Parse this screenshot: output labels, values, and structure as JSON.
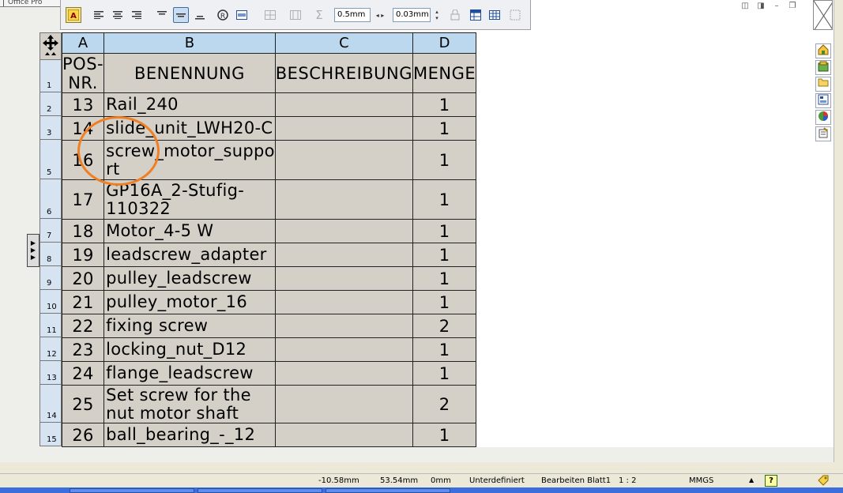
{
  "window": {
    "office_tab": "Office Pro",
    "controls": [
      "◫",
      "◨",
      "–",
      "❐"
    ]
  },
  "toolbar": {
    "line_width": "0.5mm",
    "offset": "0.03mm"
  },
  "table": {
    "columns": [
      "A",
      "B",
      "C",
      "D"
    ],
    "header": [
      "POS-NR.",
      "BENENNUNG",
      "BESCHREIBUNG",
      "MENGE"
    ],
    "rows": [
      {
        "num": "2",
        "pos": "13",
        "name": "Rail_240",
        "desc": "",
        "qty": "1"
      },
      {
        "num": "3",
        "pos": "14",
        "name": "slide_unit_LWH20-C",
        "desc": "",
        "qty": "1"
      },
      {
        "num": "5",
        "pos": "16",
        "name": "screw_motor_suppo rt",
        "desc": "",
        "qty": "1"
      },
      {
        "num": "6",
        "pos": "17",
        "name": "GP16A_2-Stufig-110322",
        "desc": "",
        "qty": "1"
      },
      {
        "num": "7",
        "pos": "18",
        "name": "Motor_4-5 W",
        "desc": "",
        "qty": "1"
      },
      {
        "num": "8",
        "pos": "19",
        "name": "leadscrew_adapter",
        "desc": "",
        "qty": "1"
      },
      {
        "num": "9",
        "pos": "20",
        "name": "pulley_leadscrew",
        "desc": "",
        "qty": "1"
      },
      {
        "num": "10",
        "pos": "21",
        "name": "pulley_motor_16",
        "desc": "",
        "qty": "1"
      },
      {
        "num": "11",
        "pos": "22",
        "name": "fixing screw",
        "desc": "",
        "qty": "2"
      },
      {
        "num": "12",
        "pos": "23",
        "name": "locking_nut_D12",
        "desc": "",
        "qty": "1"
      },
      {
        "num": "13",
        "pos": "24",
        "name": "flange_leadscrew",
        "desc": "",
        "qty": "1"
      },
      {
        "num": "14",
        "pos": "25",
        "name": "Set screw for the nut motor shaft",
        "desc": "",
        "qty": "2"
      },
      {
        "num": "15",
        "pos": "26",
        "name": "ball_bearing_-_12",
        "desc": "",
        "qty": "1"
      }
    ],
    "header_row_num": "1"
  },
  "status": {
    "x": "-10.58mm",
    "y": "53.54mm",
    "z": "0mm",
    "state": "Unterdefiniert",
    "mode": "Bearbeiten Blatt1",
    "scale": "1 : 2",
    "units": "MMGS",
    "help": "?"
  },
  "colors": {
    "cell_bg": "#d4d0c8",
    "col_header_bg": "#bcd8ee",
    "row_num_bg": "#d6e4f2",
    "annotation": "#f07f23"
  },
  "icons": {
    "move_handle": "four-way-arrow-icon",
    "text_format": "text-color-icon",
    "align_left": "align-left-icon",
    "align_center": "align-center-icon",
    "align_right": "align-right-icon",
    "valign_top": "valign-top-icon",
    "valign_middle": "valign-middle-icon",
    "valign_bottom": "valign-bottom-icon",
    "sum": "sum-icon"
  }
}
